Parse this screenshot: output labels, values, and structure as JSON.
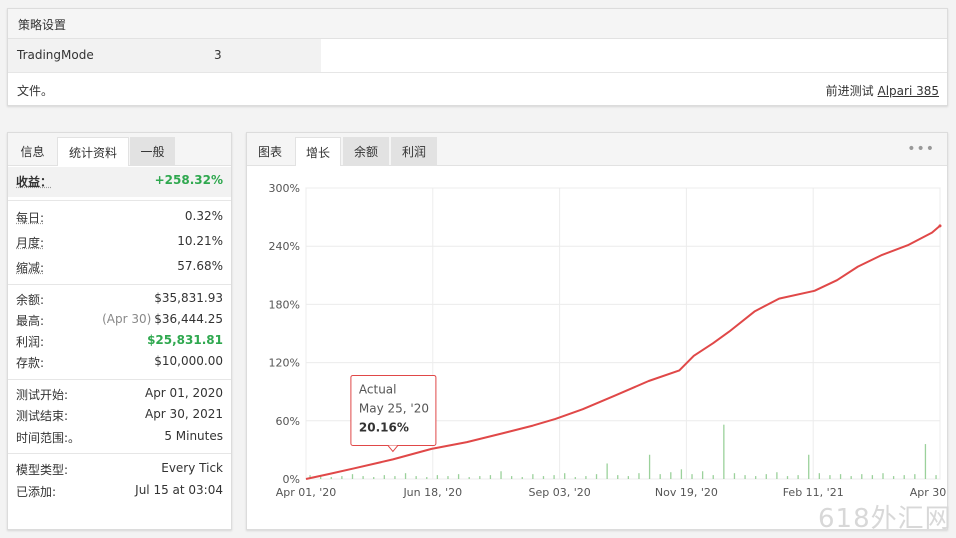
{
  "strategy": {
    "header": "策略设置",
    "mode_label": "TradingMode",
    "mode_value": "3",
    "file_text": "文件。",
    "forward_label": "前进测试",
    "forward_link": "Alpari 385"
  },
  "stats": {
    "tabs": [
      "信息",
      "统计资料",
      "一般"
    ],
    "active_tab": 1,
    "gain": {
      "label": "收益：",
      "value": "+258.32%"
    },
    "daily": {
      "label": "每日:",
      "value": "0.32%"
    },
    "monthly": {
      "label": "月度:",
      "value": "10.21%"
    },
    "drawdown": {
      "label": "缩减:",
      "value": "57.68%"
    },
    "balance": {
      "label": "余额:",
      "value": "$35,831.93"
    },
    "highest": {
      "label": "最高:",
      "date": "(Apr 30)",
      "value": "$36,444.25"
    },
    "profit": {
      "label": "利润:",
      "value": "$25,831.81"
    },
    "deposits": {
      "label": "存款:",
      "value": "$10,000.00"
    },
    "test_start": {
      "label": "测试开始:",
      "value": "Apr 01, 2020"
    },
    "test_end": {
      "label": "测试结束:",
      "value": "Apr 30, 2021"
    },
    "timeframe": {
      "label": "时间范围:。",
      "value": "5 Minutes"
    },
    "model_type": {
      "label": "模型类型:",
      "value": "Every Tick"
    },
    "added": {
      "label": "已添加:",
      "value": "Jul 15 at 03:04"
    }
  },
  "chart_tabs": [
    "图表",
    "增长",
    "余额",
    "利润"
  ],
  "chart_active_tab": 1,
  "menu_icon": "more-dots-icon",
  "watermark": "618外汇网",
  "colors": {
    "line": "#e04848",
    "bars": "#9bd19b",
    "gain_green": "#2fa84f"
  },
  "chart_data": {
    "type": "line",
    "series": [
      {
        "name": "Actual",
        "x": [
          "2020-04-01",
          "2020-04-15",
          "2020-05-01",
          "2020-05-25",
          "2020-06-18",
          "2020-07-10",
          "2020-08-01",
          "2020-08-20",
          "2020-09-03",
          "2020-09-20",
          "2020-10-10",
          "2020-10-31",
          "2020-11-19",
          "2020-11-28",
          "2020-12-10",
          "2020-12-20",
          "2021-01-05",
          "2021-01-20",
          "2021-02-11",
          "2021-02-25",
          "2021-03-10",
          "2021-03-25",
          "2021-04-10",
          "2021-04-25",
          "2021-04-30"
        ],
        "values": [
          0,
          5,
          11,
          20.16,
          31,
          38,
          47,
          55,
          62,
          72,
          86,
          101,
          112,
          127,
          140,
          152,
          173,
          186,
          194,
          205,
          219,
          231,
          241,
          254,
          261
        ]
      }
    ],
    "bars": [
      4,
      3,
      2,
      3,
      5,
      3,
      2,
      4,
      3,
      6,
      3,
      2,
      4,
      3,
      5,
      2,
      3,
      4,
      8,
      3,
      2,
      5,
      3,
      4,
      6,
      2,
      3,
      5,
      16,
      4,
      3,
      6,
      25,
      5,
      7,
      10,
      5,
      8,
      4,
      56,
      6,
      4,
      3,
      5,
      7,
      3,
      4,
      25,
      6,
      4,
      5,
      3,
      5,
      4,
      6,
      3,
      4,
      5,
      36,
      4
    ],
    "x_ticks": [
      "Apr 01, '20",
      "Jun 18, '20",
      "Sep 03, '20",
      "Nov 19, '20",
      "Feb 11, '21",
      "Apr 30, '21"
    ],
    "y_ticks": [
      "0%",
      "60%",
      "120%",
      "180%",
      "240%",
      "300%"
    ],
    "ylim": [
      0,
      300
    ],
    "tooltip": {
      "title": "Actual",
      "date": "May 25, '20",
      "value": "20.16%"
    }
  }
}
